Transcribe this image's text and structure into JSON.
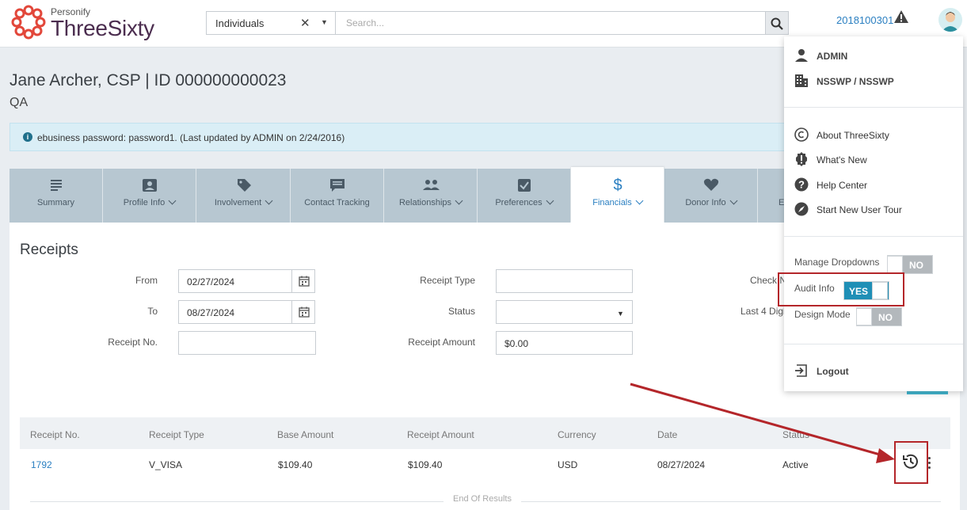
{
  "header": {
    "logo_small": "Personify",
    "logo_main": "ThreeSixty",
    "search_type": "Individuals",
    "search_placeholder": "Search...",
    "user_id": "2018100301"
  },
  "record": {
    "name": "Jane Archer, CSP | ID 000000000023",
    "sub": "QA",
    "info": "ebusiness password: password1. (Last updated by ADMIN on 2/24/2016)"
  },
  "tabs": [
    {
      "label": "Summary",
      "icon": "list-icon"
    },
    {
      "label": "Profile Info",
      "icon": "id-card-icon"
    },
    {
      "label": "Involvement",
      "icon": "tag-icon"
    },
    {
      "label": "Contact Tracking",
      "icon": "chat-icon"
    },
    {
      "label": "Relationships",
      "icon": "people-icon"
    },
    {
      "label": "Preferences",
      "icon": "checkbox-icon"
    },
    {
      "label": "Financials",
      "icon": "dollar-icon"
    },
    {
      "label": "Donor Info",
      "icon": "heart-icon"
    },
    {
      "label": "E",
      "icon": ""
    }
  ],
  "receipts": {
    "title": "Receipts",
    "from_label": "From",
    "from_value": "02/27/2024",
    "to_label": "To",
    "to_value": "08/27/2024",
    "receipt_no_label": "Receipt No.",
    "receipt_type_label": "Receipt Type",
    "status_label": "Status",
    "receipt_amount_label": "Receipt Amount",
    "receipt_amount_value": "$0.00",
    "check_label": "Check N",
    "last4_label": "Last 4 Digi",
    "columns": [
      "Receipt No.",
      "Receipt Type",
      "Base Amount",
      "Receipt Amount",
      "Currency",
      "Date",
      "Status"
    ],
    "row": [
      "1792",
      "V_VISA",
      "$109.40",
      "$109.40",
      "USD",
      "08/27/2024",
      "Active"
    ],
    "end_text": "End Of Results"
  },
  "menu": {
    "user": "ADMIN",
    "org": "NSSWP / NSSWP",
    "about": "About ThreeSixty",
    "whats_new": "What's New",
    "help": "Help Center",
    "tour": "Start New User Tour",
    "manage_dropdowns": "Manage Dropdowns",
    "manage_dropdowns_state": "NO",
    "audit_info": "Audit Info",
    "audit_info_state": "YES",
    "design_mode": "Design Mode",
    "design_mode_state": "NO",
    "logout": "Logout"
  },
  "colors": {
    "accent": "#2a7fc1",
    "toggle_on": "#1f8fb6",
    "toggle_off": "#b3b8bc",
    "annotation": "#b4262a",
    "tab_bar": "#b7c7d1"
  }
}
